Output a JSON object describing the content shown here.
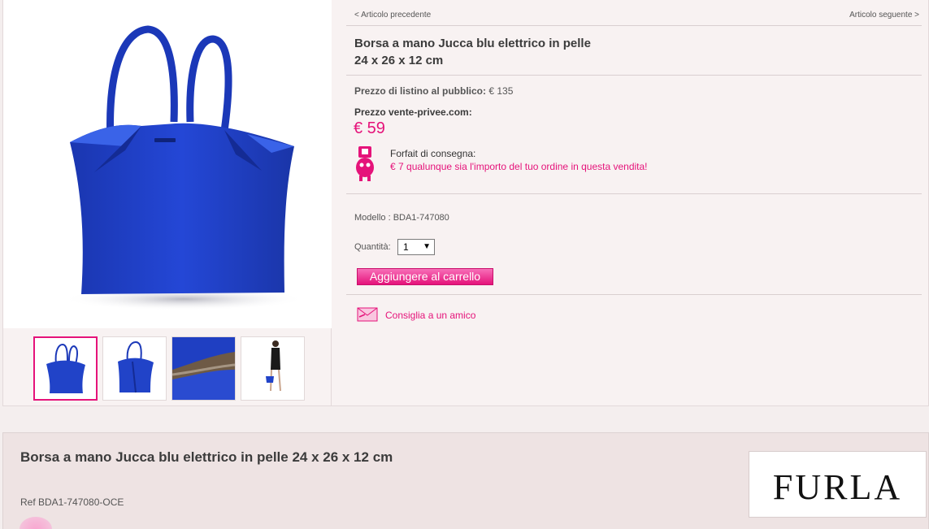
{
  "nav": {
    "prev": "< Articolo precedente",
    "next": "Articolo seguente >"
  },
  "product": {
    "title_line1": "Borsa a mano Jucca blu elettrico in pelle",
    "title_line2": "24 x 26 x 12 cm",
    "list_price_label": "Prezzo di listino al pubblico:",
    "list_price_value": " € 135",
    "vp_label": "Prezzo vente-privee.com:",
    "vp_price": "€ 59",
    "shipping_label": "Forfait di consegna:",
    "shipping_text": "€ 7 qualunque sia l'importo del tuo ordine in questa vendita!",
    "model": "Modello : BDA1-747080",
    "qty_label": "Quantità:",
    "qty_value": "1",
    "cart_button": "Aggiungere al carrello",
    "recommend": "Consiglia a un amico",
    "image_color": "#1f3fc2",
    "accent_color": "#e5137a"
  },
  "thumbnails": [
    {
      "name": "thumb-front",
      "active": true
    },
    {
      "name": "thumb-side",
      "active": false
    },
    {
      "name": "thumb-detail",
      "active": false
    },
    {
      "name": "thumb-model",
      "active": false
    }
  ],
  "description": {
    "title": "Borsa a mano Jucca blu elettrico in pelle 24 x 26 x 12 cm",
    "ref": "Ref BDA1-747080-OCE",
    "brand": "FURLA"
  }
}
